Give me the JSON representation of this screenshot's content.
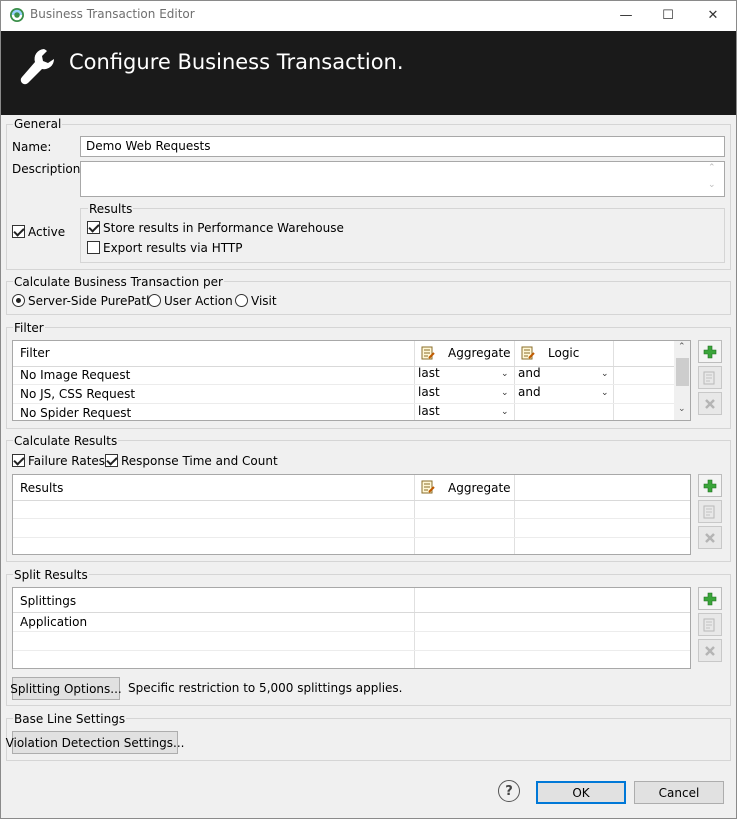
{
  "window": {
    "title": "Business Transaction Editor",
    "minimize": "—",
    "maximize": "☐",
    "close": "✕"
  },
  "banner": {
    "title": "Configure Business Transaction."
  },
  "general": {
    "group_label": "General",
    "name_label": "Name:",
    "name_value": "Demo Web Requests",
    "description_label": "Description:",
    "description_value": "",
    "active_label": "Active",
    "active_checked": true,
    "results_group_label": "Results",
    "store_label": "Store results in Performance Warehouse",
    "store_checked": true,
    "export_label": "Export results via HTTP",
    "export_checked": false
  },
  "calc_per": {
    "group_label": "Calculate Business Transaction per",
    "options": [
      "Server-Side PurePath",
      "User Action",
      "Visit"
    ],
    "selected": "Server-Side PurePath"
  },
  "filter": {
    "group_label": "Filter",
    "columns": [
      "Filter",
      "Aggregate",
      "Logic"
    ],
    "rows": [
      {
        "filter": "No Image Request",
        "aggregate": "last",
        "logic": "and"
      },
      {
        "filter": "No JS, CSS Request",
        "aggregate": "last",
        "logic": "and"
      },
      {
        "filter": "No Spider Request",
        "aggregate": "last",
        "logic": ""
      }
    ]
  },
  "calc_results": {
    "group_label": "Calculate Results",
    "failure_label": "Failure Rates",
    "failure_checked": true,
    "response_label": "Response Time and Count",
    "response_checked": true,
    "columns": [
      "Results",
      "Aggregate"
    ]
  },
  "split": {
    "group_label": "Split Results",
    "columns": [
      "Splittings"
    ],
    "rows": [
      "Application"
    ],
    "options_button": "Splitting Options...",
    "restriction_text": "Specific restriction to 5,000 splittings applies."
  },
  "baseline": {
    "group_label": "Base Line Settings",
    "violation_button": "Violation Detection Settings..."
  },
  "footer": {
    "help": "?",
    "ok": "OK",
    "cancel": "Cancel"
  },
  "colors": {
    "banner_bg": "#1a1a1a",
    "add_green": "#3aa53a",
    "default_button_border": "#0078d7"
  },
  "icons": {
    "app": "app-logo-icon",
    "banner": "wrench-icon",
    "column_header": "edit-column-icon",
    "add": "plus-icon",
    "edit": "edit-icon",
    "remove": "remove-icon",
    "help": "help-icon"
  }
}
